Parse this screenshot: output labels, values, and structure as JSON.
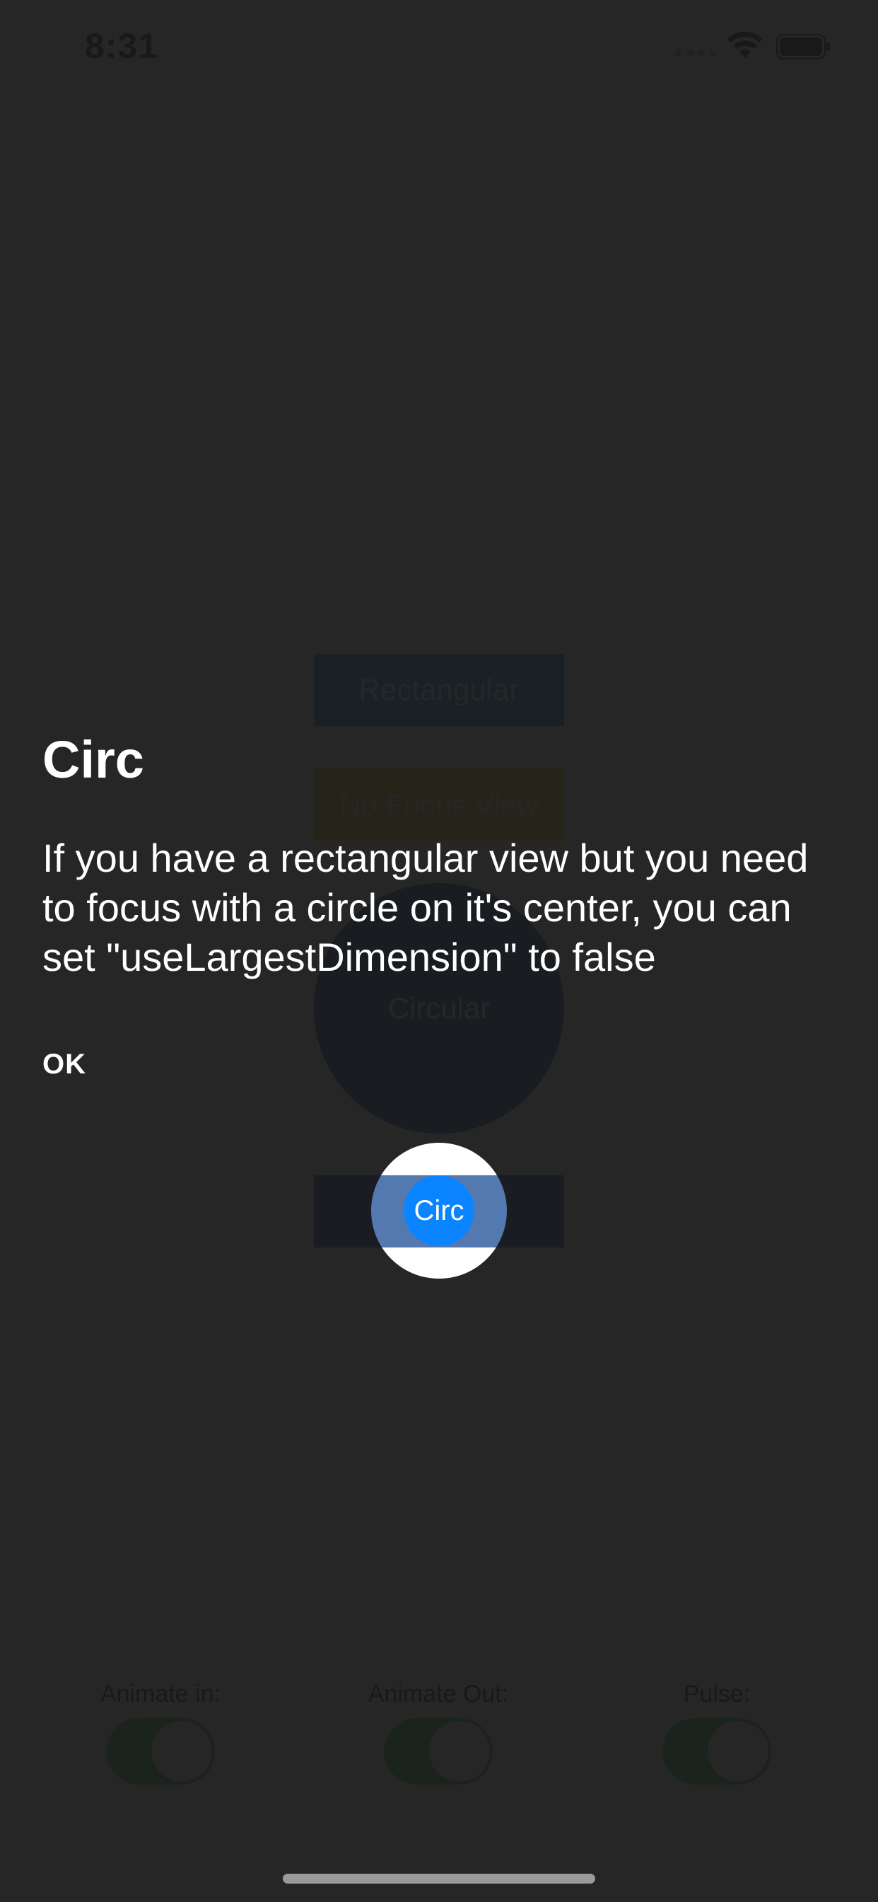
{
  "status_bar": {
    "time": "8:31",
    "icons": [
      "signal-icon",
      "wifi-icon",
      "battery-icon"
    ]
  },
  "buttons": {
    "rectangular": "Rectangular",
    "no_focus_view": "No Focus View",
    "circular": "Circular",
    "circ": "Circ"
  },
  "toggles": [
    {
      "label": "Animate in:",
      "on": true
    },
    {
      "label": "Animate Out:",
      "on": true
    },
    {
      "label": "Pulse:",
      "on": true
    }
  ],
  "tooltip": {
    "title": "Circ",
    "description": "If you have a rectangular view but you need to focus with a circle on it's center, you can set \"useLargestDimension\" to false",
    "ok_label": "OK"
  },
  "colors": {
    "overlay": "#1a1a1a",
    "rectangular": "#2196f3",
    "no_focus_view": "#ffc107",
    "circular": "#0a3f8f",
    "toggle_on": "#34c759",
    "focus_target": "#0a84ff"
  }
}
